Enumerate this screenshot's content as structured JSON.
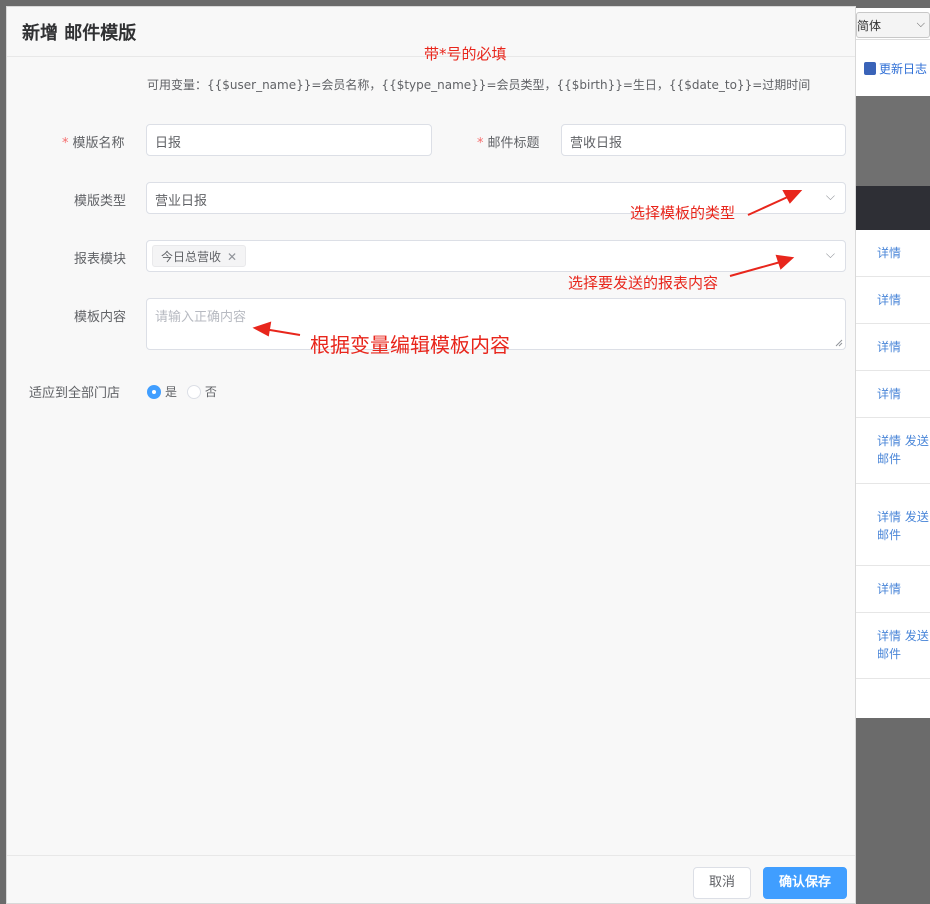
{
  "background": {
    "font_select": "简体",
    "changelog": "更新日志",
    "rows": [
      {
        "links": "详情"
      },
      {
        "links": "详情"
      },
      {
        "links": "详情"
      },
      {
        "links": "详情"
      },
      {
        "links": "详情 发送",
        "sub": "邮件"
      },
      {
        "links": "详情 发送",
        "sub": "邮件"
      },
      {
        "links": "详情"
      },
      {
        "links": "详情 发送",
        "sub": "邮件"
      }
    ]
  },
  "dialog": {
    "title": "新增 邮件模版",
    "variable_hint": "可用变量：{{$user_name}}=会员名称，{{$type_name}}=会员类型，{{$birth}}=生日，{{$date_to}}=过期时间",
    "form": {
      "template_name": {
        "label": "模版名称",
        "required": "*",
        "value": "日报"
      },
      "mail_subject": {
        "label": "邮件标题",
        "required": "*",
        "value": "营收日报"
      },
      "template_type": {
        "label": "模版类型",
        "value": "营业日报"
      },
      "report_module": {
        "label": "报表模块",
        "tags": [
          "今日总营收"
        ]
      },
      "template_content": {
        "label": "模板内容",
        "placeholder": "请输入正确内容"
      },
      "apply_all_stores": {
        "label": "适应到全部门店",
        "options": [
          "是",
          "否"
        ],
        "selected": "是"
      }
    },
    "footer": {
      "cancel": "取消",
      "save": "确认保存"
    }
  },
  "annotations": {
    "required_note": "带*号的必填",
    "type_note": "选择模板的类型",
    "report_note": "选择要发送的报表内容",
    "content_note": "根据变量编辑模板内容",
    "color": "#e8261c"
  },
  "colors": {
    "primary": "#409eff",
    "required": "#f56c6c",
    "link": "#4a86d8"
  }
}
